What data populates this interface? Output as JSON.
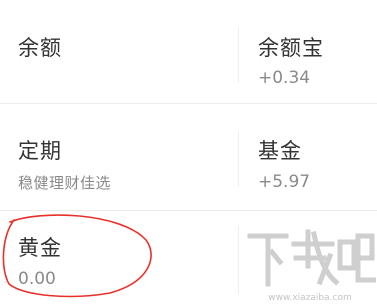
{
  "assets": {
    "balance": {
      "title": "余额",
      "subtitle": ""
    },
    "yuebao": {
      "title": "余额宝",
      "subtitle": "+0.34"
    },
    "fixed_term": {
      "title": "定期",
      "subtitle": "稳健理财佳选"
    },
    "fund": {
      "title": "基金",
      "subtitle": "+5.97"
    },
    "gold": {
      "title": "黄金",
      "subtitle": "0.00"
    }
  },
  "annotation": {
    "shape": "ellipse",
    "color": "#e8312a"
  },
  "watermark": {
    "text": "下载吧",
    "url": "www.xiazaiba.com"
  },
  "colors": {
    "title": "#333333",
    "subtitle": "#8a8a8a",
    "divider": "#ececec",
    "background": "#ffffff"
  }
}
